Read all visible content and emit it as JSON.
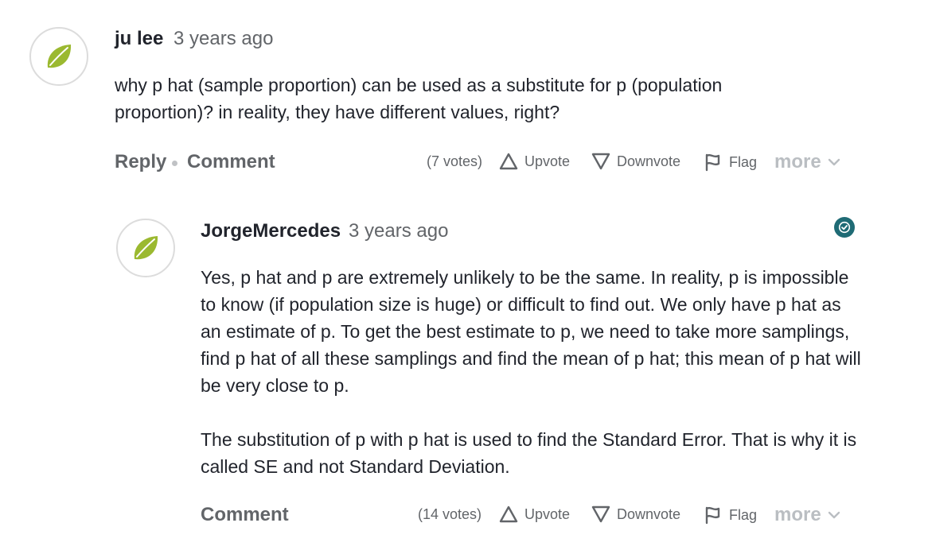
{
  "question": {
    "author": "ju lee",
    "time": "3 years ago",
    "text": "why p hat (sample proportion) can be used as a substitute for p (population proportion)? in reality, they have different values, right?",
    "actions": {
      "reply_label": "Reply",
      "comment_label": "Comment",
      "votes": "(7 votes)",
      "upvote_label": "Upvote",
      "downvote_label": "Downvote",
      "flag_label": "Flag",
      "more_label": "more"
    }
  },
  "answer": {
    "author": "JorgeMercedes",
    "time": "3 years ago",
    "paragraph1": "Yes, p hat and p are extremely unlikely to be the same. In reality, p is impossible to know (if population size is huge) or difficult to find out. We only have p hat as an estimate of p. To get the best estimate to p, we need to take more samplings, find p hat of all these samplings and find the mean of p hat; this mean of p hat will be very close to p.",
    "paragraph2": "The substitution of p with p hat is used to find the Standard Error. That is why it is called SE and not Standard Deviation.",
    "actions": {
      "comment_label": "Comment",
      "votes": "(14 votes)",
      "upvote_label": "Upvote",
      "downvote_label": "Downvote",
      "flag_label": "Flag",
      "more_label": "more"
    }
  },
  "colors": {
    "leaf": "#9bb930",
    "badge": "#1f6b75",
    "text": "#21242c",
    "muted": "#626569"
  }
}
